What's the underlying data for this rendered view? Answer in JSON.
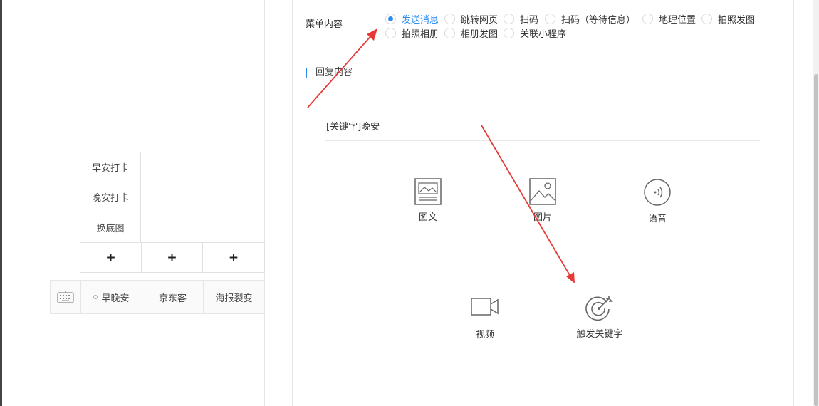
{
  "menu_preview": {
    "submenu": [
      "早安打卡",
      "晚安打卡",
      "换底图"
    ],
    "add_label": "+",
    "bottom_tabs": [
      "早晚安",
      "京东客",
      "海报裂变"
    ]
  },
  "form": {
    "menu_content_label": "菜单内容",
    "options": [
      "发送消息",
      "跳转网页",
      "扫码",
      "扫码（等待信息）",
      "地理位置",
      "拍照发图",
      "拍照相册",
      "相册发图",
      "关联小程序"
    ],
    "selected_option": "发送消息",
    "reply_section_title": "回复内容",
    "keyword_text": "[关键字]晚安",
    "reply_types": [
      "图文",
      "图片",
      "语音",
      "视频",
      "触发关键字"
    ]
  },
  "colors": {
    "accent": "#2d8cf0",
    "annotation_arrow": "#e53935",
    "border": "#e6e6e6"
  }
}
